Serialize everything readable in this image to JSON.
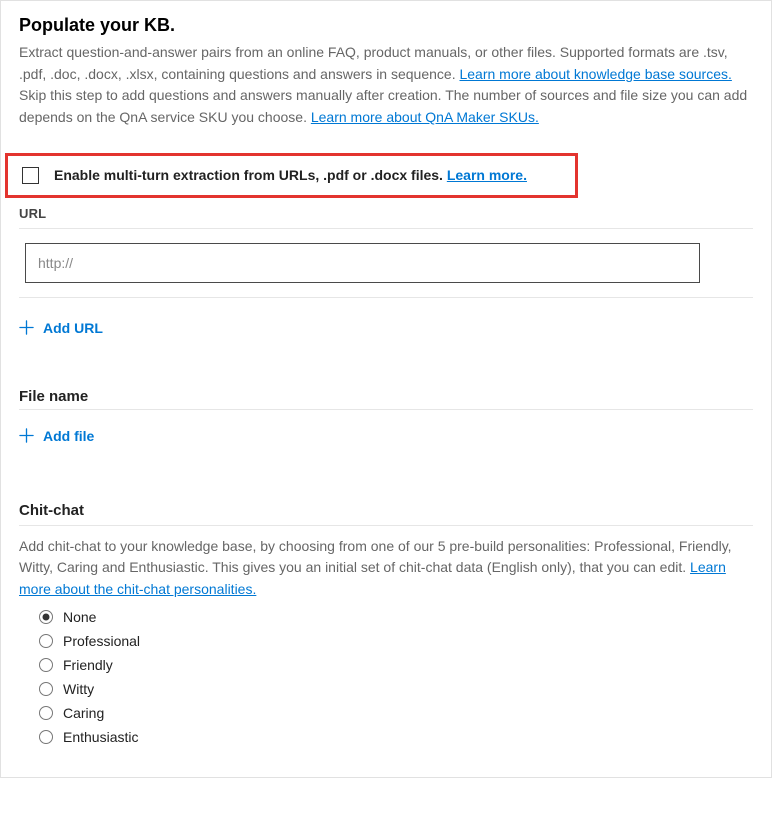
{
  "header": {
    "title": "Populate your KB.",
    "desc1": "Extract question-and-answer pairs from an online FAQ, product manuals, or other files. Supported formats are .tsv, .pdf, .doc, .docx, .xlsx, containing questions and answers in sequence. ",
    "link1": "Learn more about knowledge base sources. ",
    "desc2": "Skip this step to add questions and answers manually after creation. The number of sources and file size you can add depends on the QnA service SKU you choose. ",
    "link2": "Learn more about QnA Maker SKUs."
  },
  "multiturn": {
    "label_pre": "Enable multi-turn extraction from URLs, .pdf or .docx files. ",
    "link": "Learn more."
  },
  "url": {
    "label": "URL",
    "placeholder": "http://",
    "add": "Add URL"
  },
  "file": {
    "label": "File name",
    "add": "Add file"
  },
  "chitchat": {
    "label": "Chit-chat",
    "desc": "Add chit-chat to your knowledge base, by choosing from one of our 5 pre-build personalities: Professional, Friendly, Witty, Caring and Enthusiastic. This gives you an initial set of chit-chat data (English only), that you can edit. ",
    "link": "Learn more about the chit-chat personalities.",
    "options": [
      "None",
      "Professional",
      "Friendly",
      "Witty",
      "Caring",
      "Enthusiastic"
    ],
    "selected": 0
  }
}
